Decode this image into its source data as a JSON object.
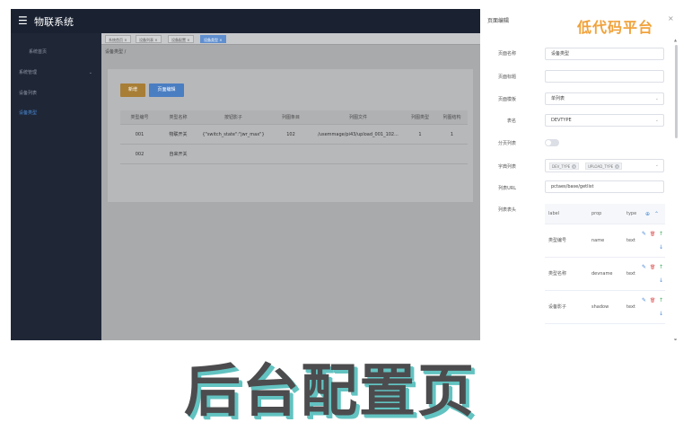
{
  "app": {
    "title": "物联系统",
    "menu_icon": "☰"
  },
  "sidebar": {
    "items": [
      {
        "label": "系统首页"
      },
      {
        "label": "系统管理",
        "arrow": "⌄"
      },
      {
        "label": "设备列表"
      },
      {
        "label": "设备类型"
      }
    ]
  },
  "tabs": [
    {
      "label": "系统首页 ×"
    },
    {
      "label": "设备列表 ×"
    },
    {
      "label": "设备配置 ×"
    },
    {
      "label": "设备类型 ×"
    }
  ],
  "breadcrumb": "设备类型  /",
  "toolbar": {
    "add_label": "新增",
    "edit_label": "页面编辑"
  },
  "table": {
    "headers": [
      "类型编号",
      "类型名称",
      "按钮影子",
      "列图条目",
      "列图文件",
      "列图类型",
      "列图结构"
    ],
    "rows": [
      [
        "001",
        "物联开关",
        "{\"switch_state\":\"jwr_max\"}",
        "102",
        "/usemmage/pi43/upload_001_102...",
        "1",
        "1"
      ],
      [
        "002",
        "自来开关",
        "",
        "",
        "",
        "",
        ""
      ]
    ]
  },
  "drawer": {
    "title": "页面编辑",
    "close": "×",
    "brand": "低代码平台",
    "fields": {
      "page_name": {
        "label": "页面名称",
        "value": "设备类型"
      },
      "page_title": {
        "label": "页面标题",
        "value": ""
      },
      "page_template": {
        "label": "页面模板",
        "value": "单列表"
      },
      "table_name": {
        "label": "表名",
        "value": "DEVTYPE"
      },
      "pagination": {
        "label": "分页列表"
      },
      "dict_list": {
        "label": "字典列表",
        "tags": [
          "DEV_TYPE",
          "UPLOAD_TYPE"
        ]
      },
      "list_url": {
        "label": "列表URL",
        "value": "pctaes/base/getlist"
      },
      "list_header": {
        "label": "列表表头"
      }
    },
    "columns": {
      "headers": [
        "label",
        "prop",
        "type"
      ],
      "rows": [
        {
          "label": "类型编号",
          "prop": "name",
          "type": "text"
        },
        {
          "label": "类型名称",
          "prop": "devname",
          "type": "text"
        },
        {
          "label": "设备影子",
          "prop": "shadow",
          "type": "text"
        }
      ]
    }
  },
  "caption": "后台配置页",
  "colors": {
    "sidebar": "#1f2737",
    "topbar": "#1a2232",
    "add_button": "#a87e36",
    "edit_button": "#4a7ec2",
    "brand": "#f0a23a",
    "caption": "#4c4c4e",
    "caption_shadow": "#62c3c1"
  },
  "icons": {
    "chevron_down": "⌄",
    "edit": "✎",
    "delete": "🗑",
    "up": "↑",
    "down": "↓",
    "add": "⊕",
    "collapse": "⌃"
  }
}
